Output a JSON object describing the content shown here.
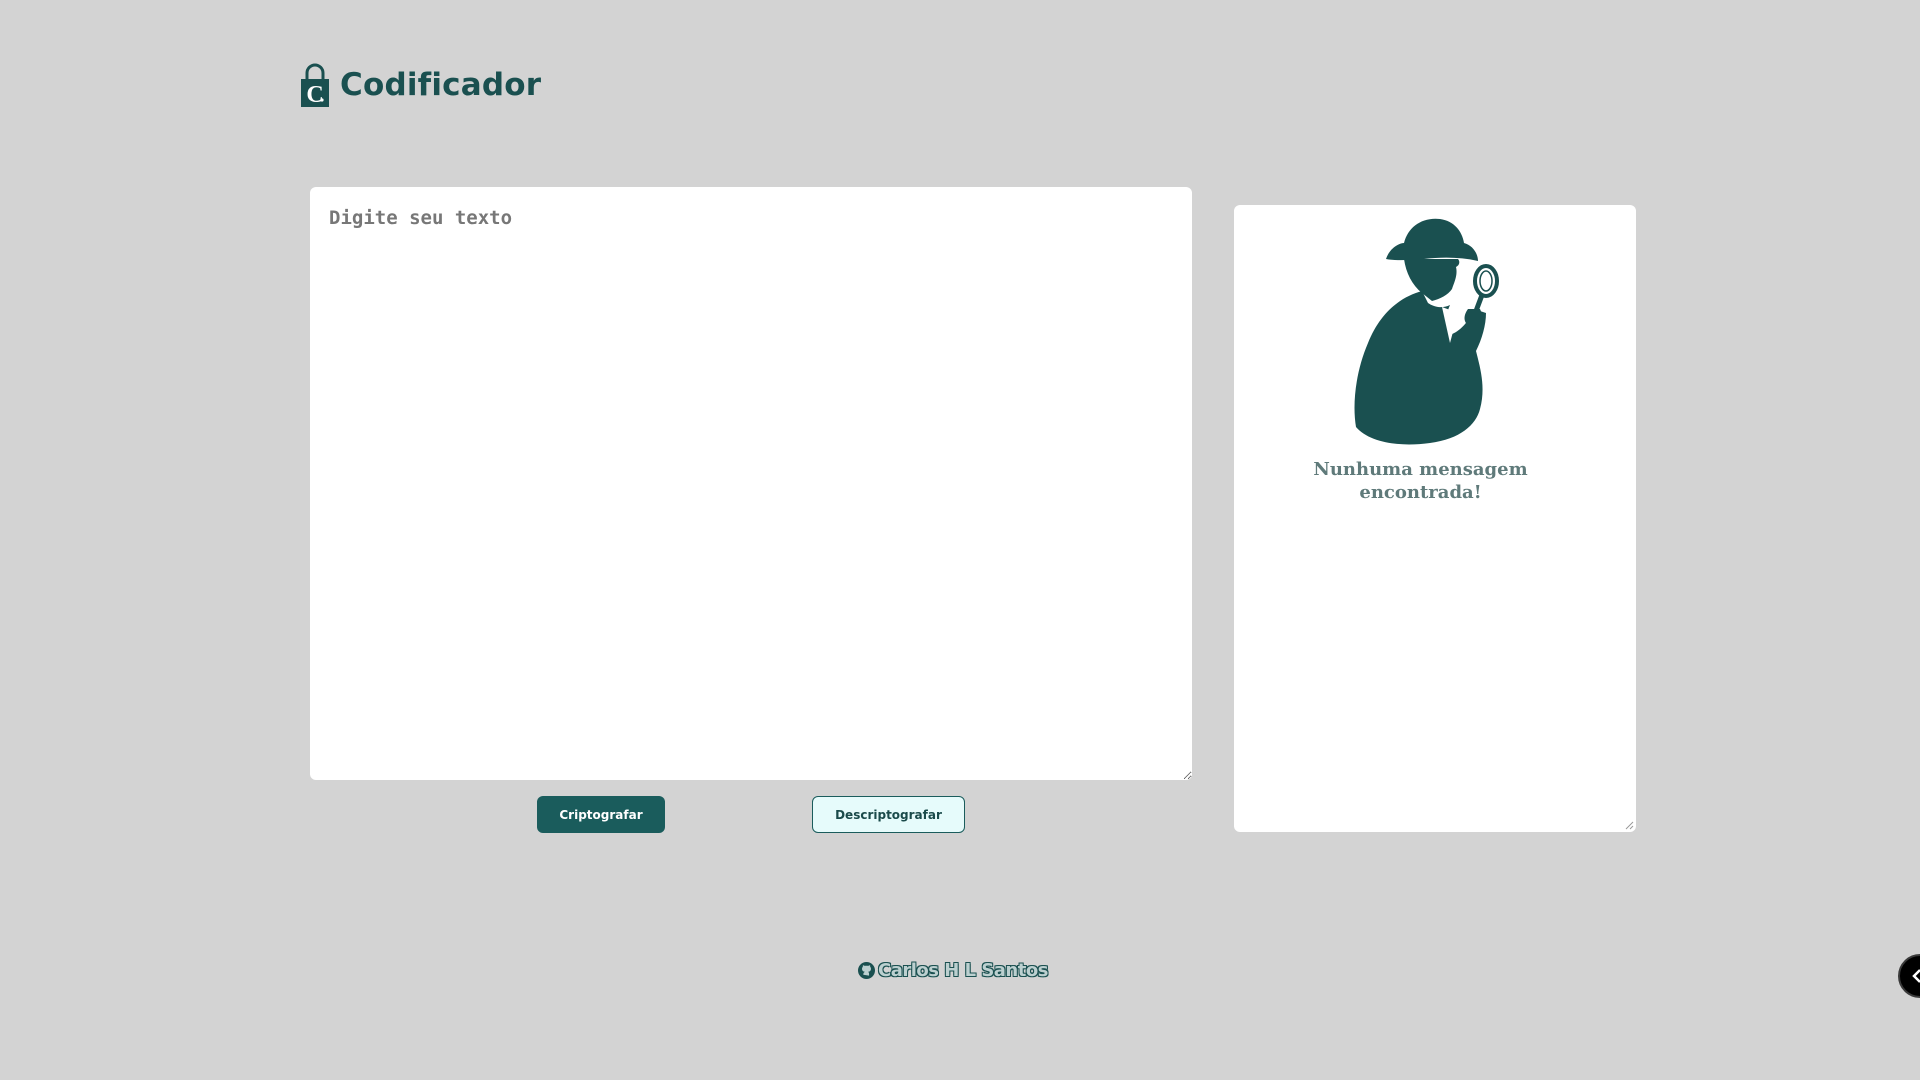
{
  "header": {
    "app_title": "Codificador",
    "logo_icon": "lock-c-icon"
  },
  "input": {
    "placeholder": "Digite seu texto",
    "value": ""
  },
  "actions": {
    "encrypt_label": "Criptografar",
    "decrypt_label": "Descriptografar"
  },
  "output": {
    "illustration": "detective-icon",
    "empty_line1": "Nunhuma mensagem",
    "empty_line2": "encontrada!"
  },
  "footer": {
    "icon": "github-icon",
    "author": "Carlos H L Santos"
  },
  "colors": {
    "background": "#d3d3d3",
    "accent": "#1a5c5c",
    "card": "#ffffff",
    "secondary_button_bg": "#e6fbfb"
  }
}
